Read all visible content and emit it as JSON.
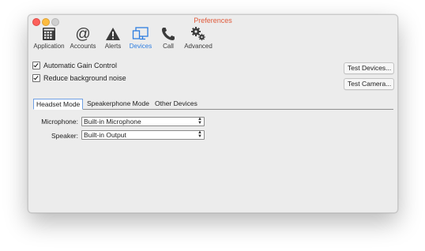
{
  "window": {
    "title": "Preferences"
  },
  "toolbar": {
    "items": [
      {
        "label": "Application",
        "icon": "application-grid-icon"
      },
      {
        "label": "Accounts",
        "icon": "at-sign-icon"
      },
      {
        "label": "Alerts",
        "icon": "warning-icon"
      },
      {
        "label": "Devices",
        "icon": "devices-icon",
        "active": true
      },
      {
        "label": "Call",
        "icon": "phone-icon"
      },
      {
        "label": "Advanced",
        "icon": "gears-icon"
      }
    ]
  },
  "options": {
    "agc_label": "Automatic Gain Control",
    "agc_checked": true,
    "noise_label": "Reduce background noise",
    "noise_checked": true
  },
  "buttons": {
    "test_devices": "Test Devices...",
    "test_camera": "Test Camera..."
  },
  "tabs": [
    {
      "label": "Headset Mode",
      "selected": true
    },
    {
      "label": "Speakerphone Mode"
    },
    {
      "label": "Other Devices"
    }
  ],
  "fields": {
    "microphone_label": "Microphone:",
    "microphone_value": "Built-in Microphone",
    "speaker_label": "Speaker:",
    "speaker_value": "Built-in Output"
  },
  "colors": {
    "accent": "#2d7de0",
    "title": "#e05b3c",
    "window_bg": "#ececec"
  }
}
